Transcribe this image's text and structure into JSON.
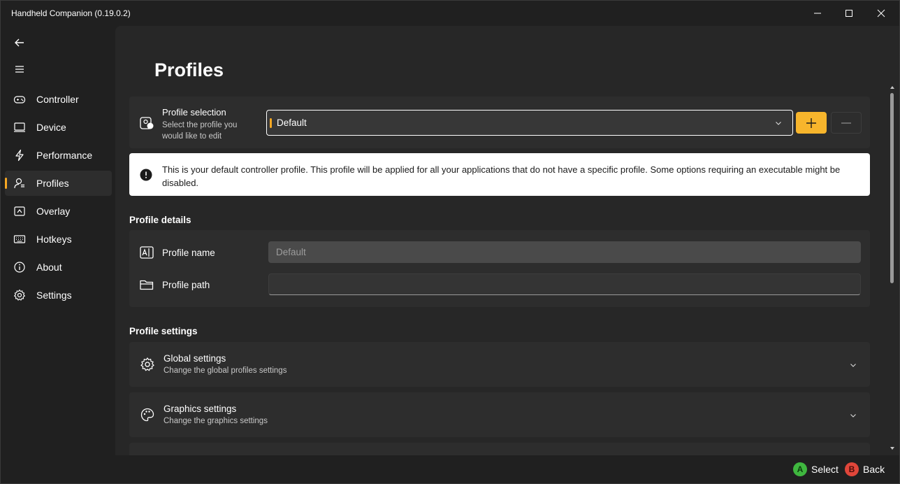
{
  "window": {
    "title": "Handheld Companion (0.19.0.2)"
  },
  "nav": {
    "items": [
      {
        "label": "Controller",
        "icon": "gamepad-icon"
      },
      {
        "label": "Device",
        "icon": "device-icon"
      },
      {
        "label": "Performance",
        "icon": "lightning-icon"
      },
      {
        "label": "Profiles",
        "icon": "profile-icon"
      },
      {
        "label": "Overlay",
        "icon": "overlay-icon"
      },
      {
        "label": "Hotkeys",
        "icon": "keyboard-icon"
      },
      {
        "label": "About",
        "icon": "info-icon"
      },
      {
        "label": "Settings",
        "icon": "gear-icon"
      }
    ],
    "active": "Profiles"
  },
  "page": {
    "title": "Profiles"
  },
  "selection": {
    "title": "Profile selection",
    "subtitle": "Select the profile you would like to edit",
    "selected": "Default"
  },
  "info": {
    "text": "This is your default controller profile. This profile will be applied for all your applications that do not have a specific profile. Some options requiring an executable might be disabled."
  },
  "details": {
    "heading": "Profile details",
    "name_label": "Profile name",
    "name_value": "Default",
    "path_label": "Profile path",
    "path_value": ""
  },
  "settings": {
    "heading": "Profile settings",
    "global_title": "Global settings",
    "global_sub": "Change the global profiles settings",
    "graphics_title": "Graphics settings",
    "graphics_sub": "Change the graphics settings"
  },
  "footer": {
    "select_key": "A",
    "select_label": "Select",
    "back_key": "B",
    "back_label": "Back"
  },
  "colors": {
    "accent": "#f7a823",
    "select_badge": "#3fb73f",
    "back_badge": "#e0463a"
  }
}
